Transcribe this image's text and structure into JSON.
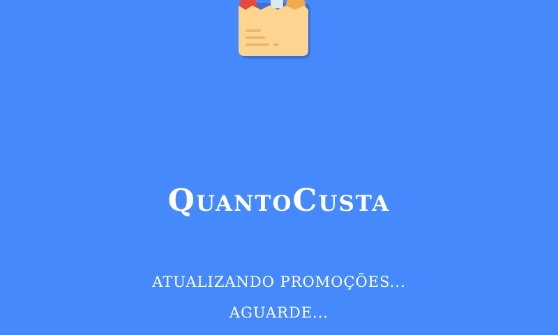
{
  "app": {
    "name": "QuantoCusta",
    "logo_icon": "grocery-bag-icon"
  },
  "status": {
    "line1": "ATUALIZANDO PROMOÇÕES...",
    "line2": "AGUARDE..."
  },
  "colors": {
    "background": "#4689fd",
    "text": "#ffffff",
    "bag": "#fdd591"
  }
}
